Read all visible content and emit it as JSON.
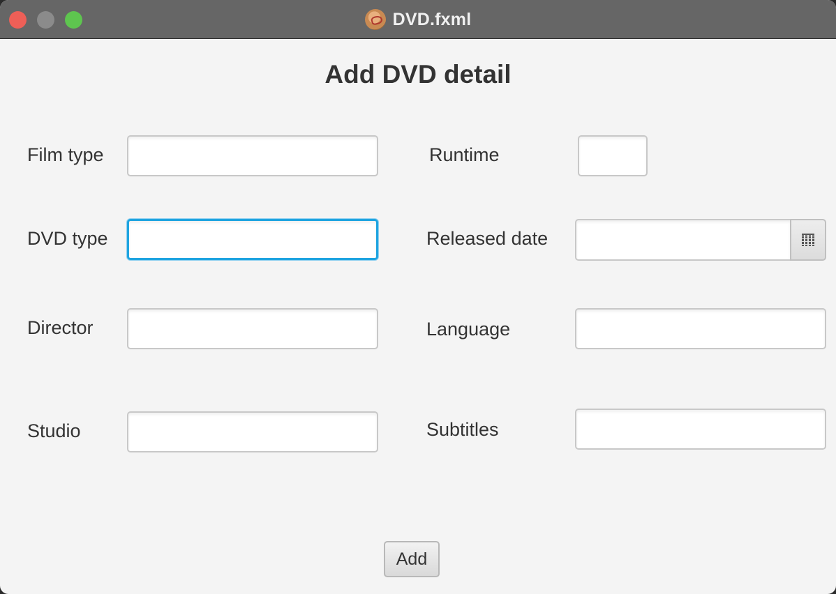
{
  "window": {
    "title": "DVD.fxml",
    "app_icon": "dvd-app-icon",
    "controls": [
      "close",
      "minimize",
      "maximize"
    ]
  },
  "form": {
    "heading": "Add DVD detail",
    "left": [
      {
        "label": "Film type",
        "value": "",
        "placeholder": ""
      },
      {
        "label": "DVD type",
        "value": "",
        "placeholder": ""
      },
      {
        "label": "Director",
        "value": "",
        "placeholder": ""
      },
      {
        "label": "Studio",
        "value": "",
        "placeholder": ""
      }
    ],
    "right": [
      {
        "label": "Runtime",
        "value": "",
        "placeholder": ""
      },
      {
        "label": "Released date",
        "value": "",
        "placeholder": ""
      },
      {
        "label": "Language",
        "value": "",
        "placeholder": ""
      },
      {
        "label": "Subtitles",
        "value": "",
        "placeholder": ""
      }
    ],
    "calendar_icon": "calendar-icon",
    "focused_field": "DVD type",
    "add_label": "Add"
  },
  "colors": {
    "titlebar": "#666666",
    "background": "#f4f4f4",
    "focus": "#1fa4e0",
    "close": "#ee5f57",
    "minimize": "#8b8b8b",
    "maximize": "#5ec54f"
  }
}
